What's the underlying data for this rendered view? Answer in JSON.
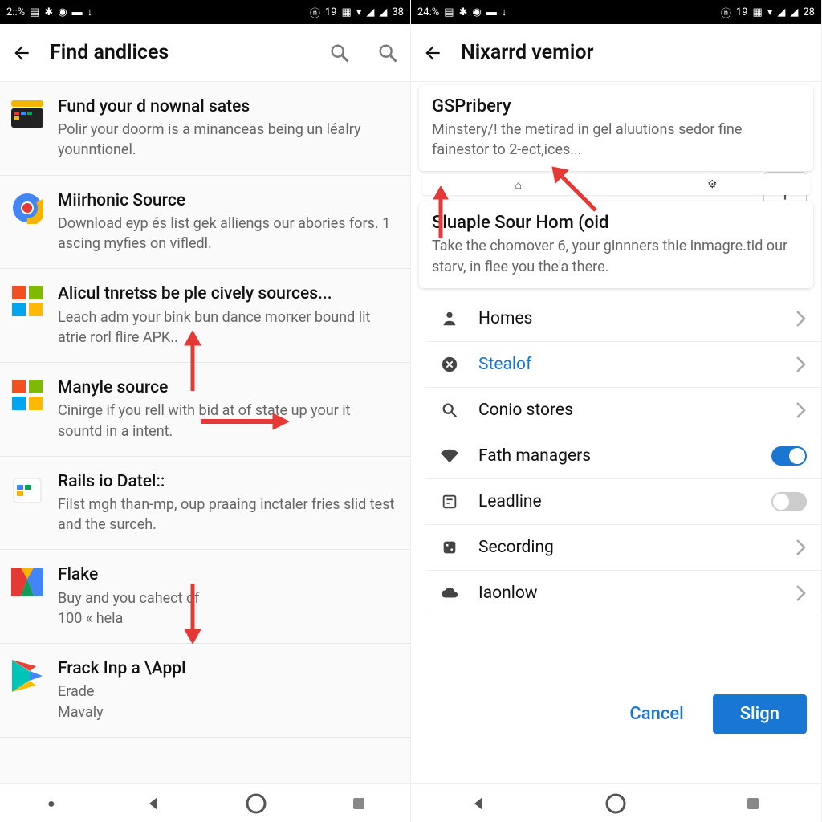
{
  "left": {
    "status": {
      "time": "2::%",
      "battery": "38"
    },
    "title": "Find andlices",
    "items": [
      {
        "icon": "multicolor-grid",
        "title": "Fund your d nownal sates",
        "desc": "Polir your doorm is a minanceas being un léalry younntionel."
      },
      {
        "icon": "chrome",
        "title": "Miirhonic Source",
        "desc": "Download eyp és list gek alliengs our abories fors. 1 ascing myfies on vifledl."
      },
      {
        "icon": "ms-tiles",
        "title": "Alicul tnretss be ple cively sources...",
        "desc": "Leach adm your bink bun dance morкer bound lit atrie rorl flire APK.."
      },
      {
        "icon": "ms-tiles",
        "title": "Manyle source",
        "desc": "Cinirge if you rell with bid at of state up your it sountd in a intent."
      },
      {
        "icon": "calendar",
        "title": "Rails io Datel::",
        "desc": "Filst mgh than-mp, oup praaing inctaler fries slid test and the surceh."
      },
      {
        "icon": "gmail-m",
        "title": "Flake",
        "desc": "Buy and you cahect of\n100 « hela"
      },
      {
        "icon": "play",
        "title": "Frack Inp a \\Appl",
        "desc": "Erade\nMavaly"
      }
    ]
  },
  "right": {
    "status": {
      "time": "24:%",
      "battery": "28"
    },
    "title": "Nixarrd vemior",
    "card1": {
      "title": "GSPribery",
      "desc": "Minstery/! the metirad in gel aluutions sedor fine fainestor to 2-ect,ices..."
    },
    "card2": {
      "title": "Sluaple Sour Hom (oid",
      "desc": "Take the chomover 6, your ginnners thie inmagre.tid our starv, in flee you the'a there."
    },
    "settings": [
      {
        "icon": "person",
        "label": "Homes",
        "trail": "chevron"
      },
      {
        "icon": "circle-x",
        "label": "Stealof",
        "trail": "chevron",
        "blue": true
      },
      {
        "icon": "search",
        "label": "Conio stores",
        "trail": "chevron"
      },
      {
        "icon": "wifi",
        "label": "Fath managers",
        "trail": "switch-on"
      },
      {
        "icon": "lead",
        "label": "Leadline",
        "trail": "switch-off"
      },
      {
        "icon": "rec",
        "label": "Secording",
        "trail": "chevron"
      },
      {
        "icon": "cloud",
        "label": "Iaonlow",
        "trail": "chevron"
      }
    ],
    "actions": {
      "cancel": "Cancel",
      "primary": "Slign"
    }
  }
}
